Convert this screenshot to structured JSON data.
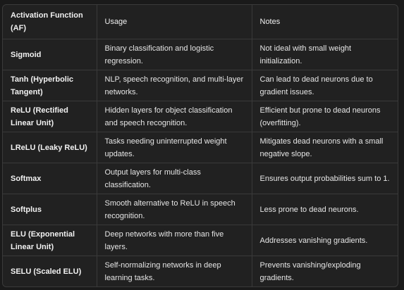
{
  "table": {
    "headers": [
      "Activation Function (AF)",
      "Usage",
      "Notes"
    ],
    "rows": [
      {
        "name": "Sigmoid",
        "usage": "Binary classification and logistic regression.",
        "notes": "Not ideal with small weight initialization."
      },
      {
        "name": "Tanh (Hyperbolic Tangent)",
        "usage": "NLP, speech recognition, and multi-layer networks.",
        "notes": "Can lead to dead neurons due to gradient issues."
      },
      {
        "name": "ReLU (Rectified Linear Unit)",
        "usage": "Hidden layers for object classification and speech recognition.",
        "notes": "Efficient but prone to dead neurons (overfitting)."
      },
      {
        "name": "LReLU (Leaky ReLU)",
        "usage": "Tasks needing uninterrupted weight updates.",
        "notes": "Mitigates dead neurons with a small negative slope."
      },
      {
        "name": "Softmax",
        "usage": "Output layers for multi-class classification.",
        "notes": "Ensures output probabilities sum to 1."
      },
      {
        "name": "Softplus",
        "usage": "Smooth alternative to ReLU in speech recognition.",
        "notes": "Less prone to dead neurons."
      },
      {
        "name": "ELU (Exponential Linear Unit)",
        "usage": "Deep networks with more than five layers.",
        "notes": "Addresses vanishing gradients."
      },
      {
        "name": "SELU (Scaled ELU)",
        "usage": "Self-normalizing networks in deep learning tasks.",
        "notes": "Prevents vanishing/exploding gradients."
      }
    ]
  }
}
